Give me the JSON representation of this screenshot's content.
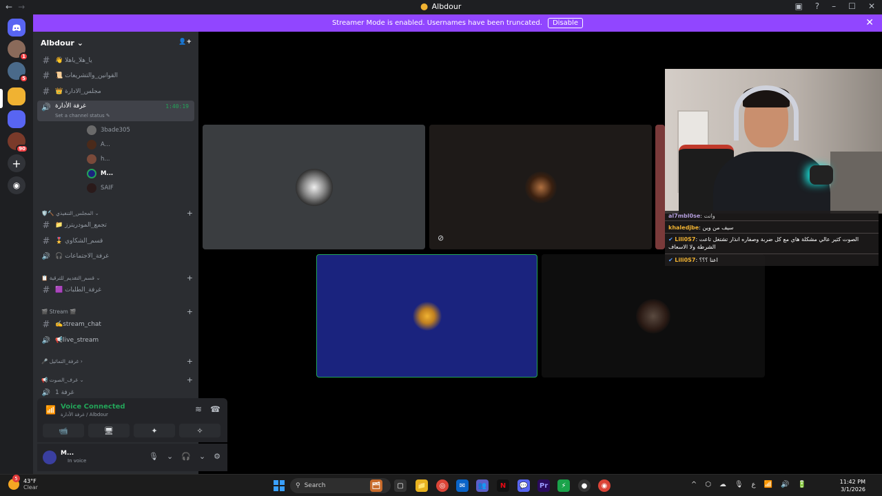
{
  "window": {
    "title": "Albdour",
    "back": "←",
    "forward": "→",
    "help": "?",
    "minimize": "–",
    "maximize": "☐",
    "close": "✕",
    "inbox": "▣"
  },
  "banner": {
    "text": "Streamer Mode is enabled. Usernames have been truncated.",
    "disable_label": "Disable",
    "close": "✕"
  },
  "rail": {
    "servers": [
      {
        "glyph": "",
        "badge": "1"
      },
      {
        "glyph": "",
        "badge": "5"
      },
      {
        "glyph": "",
        "badge": ""
      },
      {
        "glyph": "",
        "badge": ""
      },
      {
        "glyph": "",
        "badge": "90"
      }
    ],
    "add": "+",
    "discover": "◉"
  },
  "sidebar": {
    "guild_name": "Albdour",
    "invite_icon": "👤+",
    "channels_top": [
      {
        "type": "#",
        "name": "👋 يا_هلا_ياهلا"
      },
      {
        "type": "#",
        "name": "📜 القوانين_والتشريعات"
      },
      {
        "type": "#",
        "name": "👑 مجلس_الادارة"
      }
    ],
    "active_voice": {
      "name": "غرفة الأدارة",
      "timer": "1:40:19",
      "status": "Set a channel status ✎"
    },
    "voice_users": [
      "3bade305",
      "A...",
      "h...",
      "M...",
      "SAIF"
    ],
    "categories": [
      {
        "name": "🛡️🔨 المجلس_التنفيذي",
        "channels": [
          {
            "type": "#",
            "name": "📁 تجمع_المودريترز"
          },
          {
            "type": "#",
            "name": "🎖️ قسم_الشكاوي"
          },
          {
            "type": "🔊",
            "name": "🎧 غرفة_الاجتماعات"
          }
        ]
      },
      {
        "name": "📋 قسم_التقديم_للترقية",
        "channels": [
          {
            "type": "#",
            "name": "🟪 غرفة_الطلبات"
          }
        ]
      },
      {
        "name": "🎬 Stream 🎬",
        "channels": [
          {
            "type": "#",
            "name": "✍️stream_chat"
          },
          {
            "type": "🔊",
            "name": "📢live_stream"
          }
        ]
      },
      {
        "name": "🎤 غرفة_التماثيل",
        "channels": []
      },
      {
        "name": "📢 غرف_الصوت",
        "channels": [
          {
            "type": "🔊",
            "name": "غرفة 1"
          }
        ]
      }
    ],
    "plus": "+"
  },
  "voice_panel": {
    "title": "Voice Connected",
    "subtitle": "غرفة الأدارة / Albdour",
    "signal": "📶",
    "noise": "≋",
    "disconnect": "☎",
    "buttons": [
      "📹",
      "🖥",
      "✦",
      "✧"
    ]
  },
  "user_panel": {
    "name": "M...",
    "status": "In voice",
    "mic": "🎙",
    "headset": "🎧",
    "settings": "⚙",
    "caret": "⌄"
  },
  "chat": [
    {
      "name": "al7mbl0se",
      "text": "وانت"
    },
    {
      "name": "khaledjbe",
      "text": "سيف من وين"
    },
    {
      "name": "Lili0S7",
      "text": "الصوت كثير عالي مشكلة هاي مع كل ضربة وصفاره انذار تشتغل تاعت الشرطة ولا الاسعاف"
    },
    {
      "name": "Lili0S7",
      "text": "اعنا ؟؟؟"
    }
  ],
  "taskbar": {
    "weather_temp": "43°F",
    "weather_desc": "Clear",
    "weather_badge": "5",
    "search_placeholder": "Search",
    "apps": [
      "🗂",
      "▢",
      "📁",
      "◎",
      "✉",
      "👥",
      "N",
      "💬",
      "Pr",
      "⚡",
      "●",
      "◉"
    ],
    "tray_icons": [
      "^",
      "⬡",
      "☁",
      "🎙",
      "ع",
      "📶",
      "🔊",
      "🔋"
    ],
    "time": "11:42 PM",
    "date": "3/1/2026"
  },
  "colors": {
    "accent": "#9146ff",
    "speaking": "#23a559",
    "blurple": "#5865f2",
    "tile_blue": "#1a237e"
  }
}
